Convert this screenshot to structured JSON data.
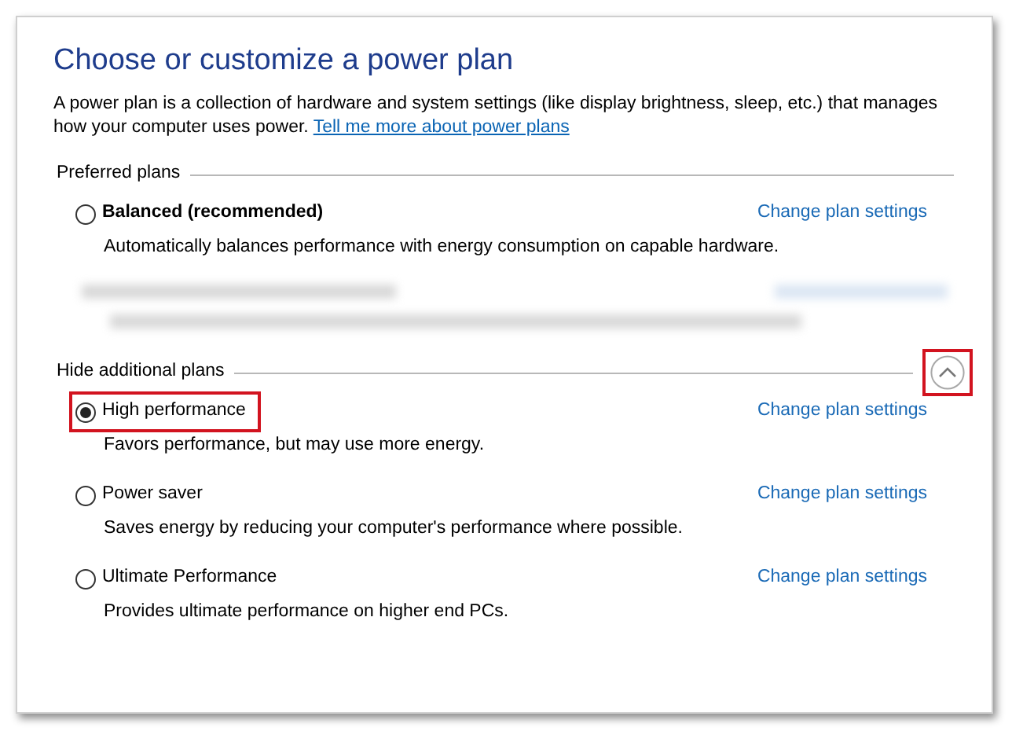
{
  "title": "Choose or customize a power plan",
  "intro": {
    "text": "A power plan is a collection of hardware and system settings (like display brightness, sleep, etc.) that manages how your computer uses power.",
    "link": "Tell me more about power plans"
  },
  "sections": [
    {
      "heading": "Preferred plans",
      "plans": [
        {
          "kind": "plan",
          "name": "Balanced (recommended)",
          "emphasized": true,
          "selected": false,
          "highlighted": false,
          "description": "Automatically balances performance with energy consumption on capable hardware.",
          "link": "Change plan settings"
        },
        {
          "kind": "blurred"
        }
      ]
    },
    {
      "heading": "Hide additional plans",
      "toggle": {
        "expanded": true,
        "highlighted": true
      },
      "plans": [
        {
          "kind": "plan",
          "name": "High performance",
          "emphasized": false,
          "selected": true,
          "highlighted": true,
          "description": "Favors performance, but may use more energy.",
          "link": "Change plan settings"
        },
        {
          "kind": "plan",
          "name": "Power saver",
          "emphasized": false,
          "selected": false,
          "highlighted": false,
          "description": "Saves energy by reducing your computer's performance where possible.",
          "link": "Change plan settings"
        },
        {
          "kind": "plan",
          "name": "Ultimate Performance",
          "emphasized": false,
          "selected": false,
          "highlighted": false,
          "description": "Provides ultimate performance on higher end PCs.",
          "link": "Change plan settings"
        }
      ]
    }
  ]
}
